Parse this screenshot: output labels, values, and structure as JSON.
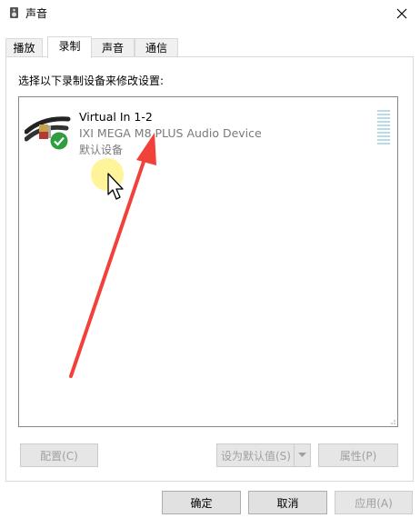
{
  "window": {
    "title": "声音"
  },
  "tabs": [
    {
      "label": "播放",
      "active": false
    },
    {
      "label": "录制",
      "active": true
    },
    {
      "label": "声音",
      "active": false
    },
    {
      "label": "通信",
      "active": false
    }
  ],
  "panel": {
    "instruction": "选择以下录制设备来修改设置:"
  },
  "device": {
    "name": "Virtual In 1-2",
    "driver": "IXI MEGA M8 PLUS Audio Device",
    "status": "默认设备",
    "icon": "audio-cable-icon",
    "badge": "check-badge-icon"
  },
  "buttons": {
    "configure": "配置(C)",
    "set_default": "设为默认值(S)",
    "properties": "属性(P)",
    "ok": "确定",
    "cancel": "取消",
    "apply": "应用(A)"
  },
  "colors": {
    "accent_arrow": "#f2413b",
    "badge_green": "#2e9e3e",
    "meter": "#b9dbe9"
  }
}
